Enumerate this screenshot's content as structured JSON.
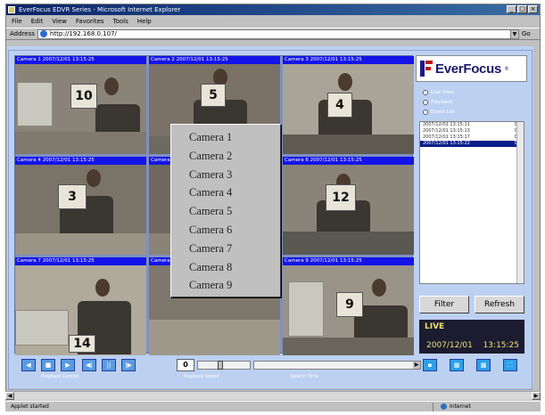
{
  "window": {
    "title": "EverFocus EDVR Series - Microsoft Internet Explorer",
    "buttons": [
      "_",
      "□",
      "×"
    ]
  },
  "menubar": {
    "items": [
      "File",
      "Edit",
      "View",
      "Favorites",
      "Tools",
      "Help"
    ]
  },
  "address": {
    "label": "Address",
    "value": "http://192.168.0.107/",
    "go": "Go"
  },
  "cameras": [
    {
      "label": "Camera 1  2007/12/01 13:15:25",
      "number": "10"
    },
    {
      "label": "Camera 2  2007/12/01 13:15:25",
      "number": "5"
    },
    {
      "label": "Camera 3  2007/12/01 13:15:25",
      "number": "4"
    },
    {
      "label": "Camera 4  2007/12/01 13:15:25",
      "number": "3"
    },
    {
      "label": "Camera 5  2007/12/01 13:15:25",
      "number": ""
    },
    {
      "label": "Camera 6  2007/12/01 13:15:25",
      "number": "12"
    },
    {
      "label": "Camera 7  2007/12/01 13:15:25",
      "number": "14"
    },
    {
      "label": "Camera 8  2007/12/01 13:15:25",
      "number": ""
    },
    {
      "label": "Camera 9  2007/12/01 13:15:25",
      "number": "9"
    }
  ],
  "context_menu": {
    "items": [
      "Camera 1",
      "Camera 2",
      "Camera 3",
      "Camera 4",
      "Camera 5",
      "Camera 6",
      "Camera 7",
      "Camera 8",
      "Camera 9"
    ]
  },
  "sidebar": {
    "logo": "EverFocus",
    "logo_tm": "®",
    "radios": [
      "Live View",
      "Playback",
      "Event List"
    ],
    "events": [
      {
        "time": "2007/12/01 13:15:11",
        "code": "01"
      },
      {
        "time": "2007/12/01 13:15:13",
        "code": "02"
      },
      {
        "time": "2007/12/01 13:15:17",
        "code": "03"
      },
      {
        "time": "2007/12/01 13:15:22",
        "code": "04"
      }
    ],
    "filter_label": "Filter",
    "refresh_label": "Refresh",
    "clock_mode": "LIVE",
    "clock_date": "2007/12/01",
    "clock_time": "13:15:25"
  },
  "controls": {
    "speed": "0",
    "labels": [
      "Playback Control",
      "Playback Speed",
      "Search Time"
    ]
  },
  "statusbar": {
    "left": "Applet started",
    "right": "Internet"
  }
}
